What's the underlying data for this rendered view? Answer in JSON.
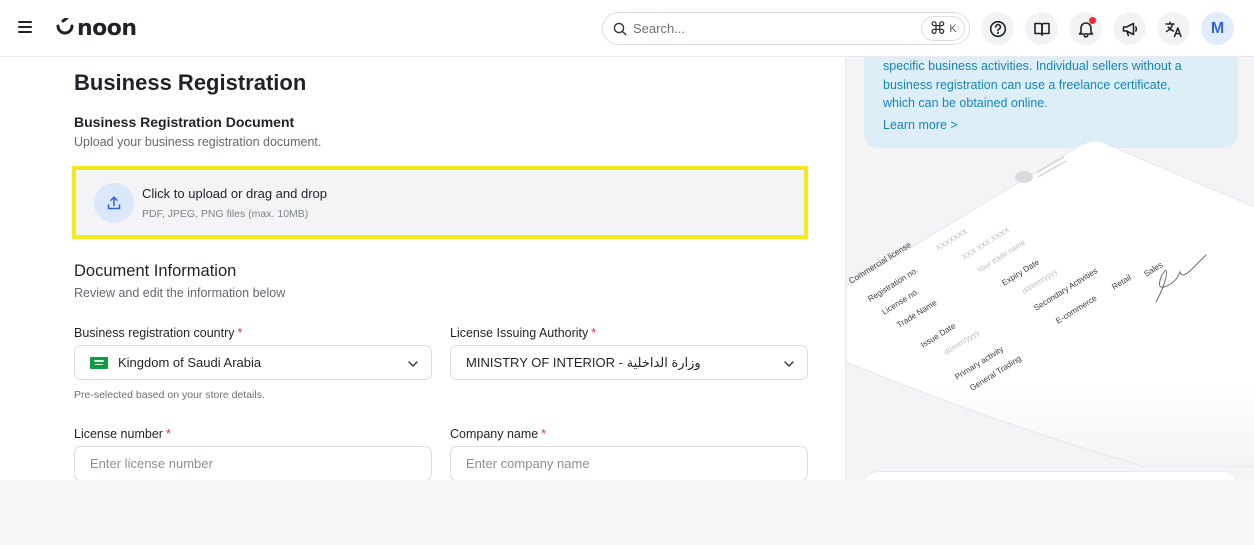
{
  "header": {
    "logo_text": "noon",
    "search_placeholder": "Search...",
    "shortcut_key": "K",
    "avatar_initial": "M"
  },
  "main": {
    "title": "Business Registration",
    "doc_section": {
      "title": "Business Registration Document",
      "subtitle": "Upload your business registration document."
    },
    "upload": {
      "main_text": "Click to upload or drag and drop",
      "hint": "PDF, JPEG, PNG files (max. 10MB)"
    },
    "info_section": {
      "title": "Document Information",
      "subtitle": "Review and edit the information below"
    },
    "fields": {
      "country": {
        "label": "Business registration country",
        "required_mark": "*",
        "value": "Kingdom of Saudi Arabia",
        "hint": "Pre-selected based on your store details."
      },
      "authority": {
        "label": "License Issuing Authority",
        "required_mark": "*",
        "value": "MINISTRY OF INTERIOR - وزارة الداخلية"
      },
      "license_number": {
        "label": "License number",
        "required_mark": "*",
        "placeholder": "Enter license number"
      },
      "company_name": {
        "label": "Company name",
        "required_mark": "*",
        "placeholder": "Enter company name"
      }
    }
  },
  "aside": {
    "info_text": "specific business activities. Individual sellers without a business registration can use a freelance certificate, which can be obtained online.",
    "learn_more": "Learn more >",
    "license_sample": {
      "commercial_license": "Commercial license",
      "registration_no": "Registration no.",
      "license_no": "License no.",
      "trade_name": "Trade Name",
      "issue_date": "Issue Date",
      "primary_activity": "Primary activity",
      "general_trading": "General Trading",
      "xxxxxx": "XXXXXXX",
      "xxx_xxx": "XXX XXX XXXX",
      "your_trade_name": "Your trade name",
      "expiry_date": "Expiry Date",
      "dd_mm_yyyy_1": "dd/mm/yyyy",
      "dd_mm_yyyy_2": "dd/mm/yyyy",
      "secondary_activities": "Secondary Activities",
      "ecommerce": "E-commerce",
      "retail": "Retail",
      "sales": "Sales"
    }
  }
}
